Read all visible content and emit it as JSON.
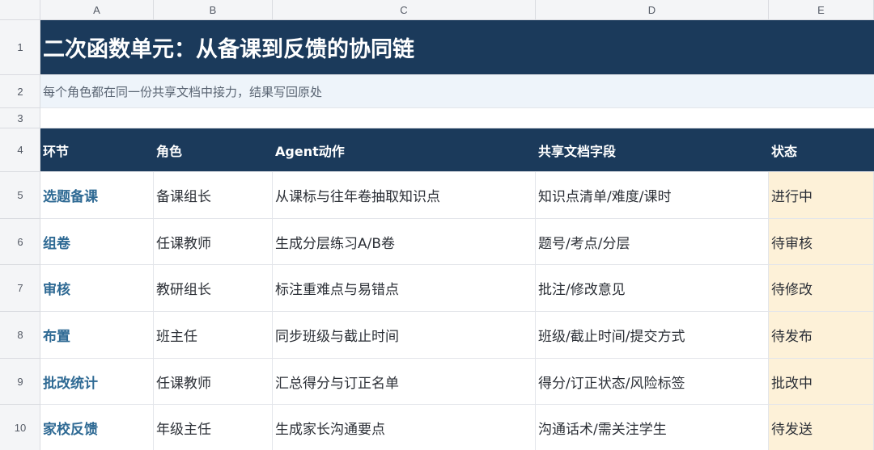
{
  "columns": [
    "A",
    "B",
    "C",
    "D",
    "E"
  ],
  "row_numbers": [
    "1",
    "2",
    "3",
    "4",
    "5",
    "6",
    "7",
    "8",
    "9",
    "10"
  ],
  "title": "二次函数单元：从备课到反馈的协同链",
  "subtitle": "每个角色都在同一份共享文档中接力，结果写回原处",
  "table": {
    "headers": [
      "环节",
      "角色",
      "Agent动作",
      "共享文档字段",
      "状态"
    ],
    "rows": [
      [
        "选题备课",
        "备课组长",
        "从课标与往年卷抽取知识点",
        "知识点清单/难度/课时",
        "进行中"
      ],
      [
        "组卷",
        "任课教师",
        "生成分层练习A/B卷",
        "题号/考点/分层",
        "待审核"
      ],
      [
        "审核",
        "教研组长",
        "标注重难点与易错点",
        "批注/修改意见",
        "待修改"
      ],
      [
        "布置",
        "班主任",
        "同步班级与截止时间",
        "班级/截止时间/提交方式",
        "待发布"
      ],
      [
        "批改统计",
        "任课教师",
        "汇总得分与订正名单",
        "得分/订正状态/风险标签",
        "批改中"
      ],
      [
        "家校反馈",
        "年级主任",
        "生成家长沟通要点",
        "沟通话术/需关注学生",
        "待发送"
      ]
    ]
  },
  "colors": {
    "title_bg": "#1b3a5b",
    "subtitle_bg": "#eef4fa",
    "stage_text": "#2f6a94",
    "status_bg": "#fdf1d8"
  }
}
